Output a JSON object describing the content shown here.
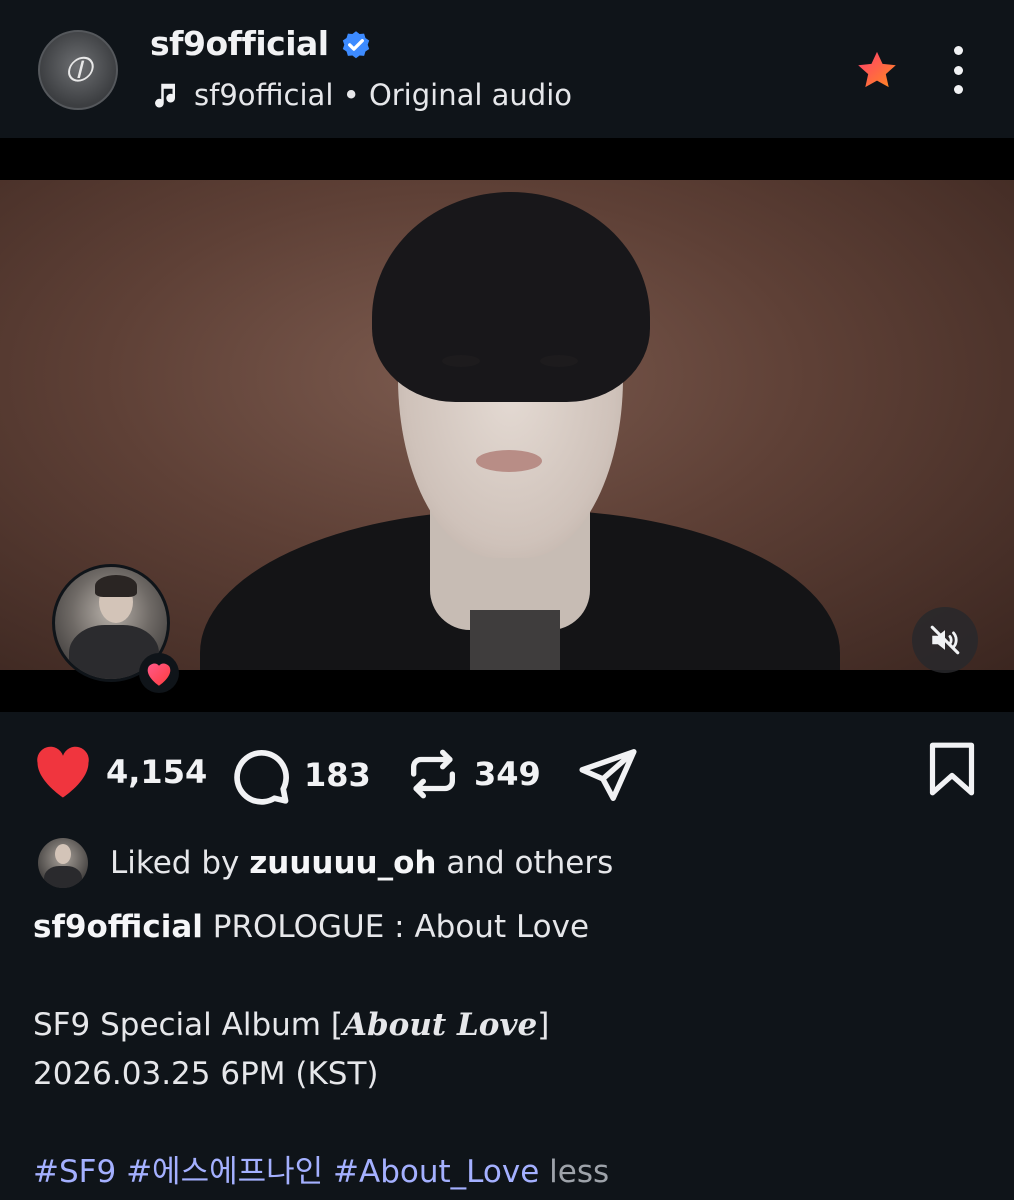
{
  "header": {
    "avatar_monogram": "⦶",
    "username": "sf9official",
    "audio_artist": "sf9official",
    "audio_separator": "•",
    "audio_label": "Original audio"
  },
  "icons": {
    "verified": "verified-badge-icon",
    "music": "music-note-icon",
    "star": "favorite-star-icon",
    "more": "more-vertical-icon",
    "mute": "muted-speaker-icon",
    "like": "heart-icon",
    "comment": "comment-bubble-icon",
    "repost": "repost-icon",
    "share": "send-icon",
    "save": "bookmark-icon"
  },
  "colors": {
    "background": "#0f1419",
    "verified": "#3d8bff",
    "like": "#f0353e",
    "hashtag": "#a4b0ff",
    "star_outer": "#ff4d3a",
    "star_inner": "#ffb020"
  },
  "actions": {
    "likes": "4,154",
    "comments": "183",
    "reposts": "349"
  },
  "liked_by": {
    "prefix": "Liked by",
    "user": "zuuuuu_oh",
    "suffix": "and others"
  },
  "caption": {
    "author": "sf9official",
    "title": "PROLOGUE : About Love",
    "album_prefix": "SF9 Special Album [",
    "album_name": "About Love",
    "album_suffix": "]",
    "release": "2026.03.25 6PM (KST)",
    "hashtags": [
      "#SF9",
      "#에스에프나인",
      "#About_Love"
    ],
    "less_label": "less"
  }
}
